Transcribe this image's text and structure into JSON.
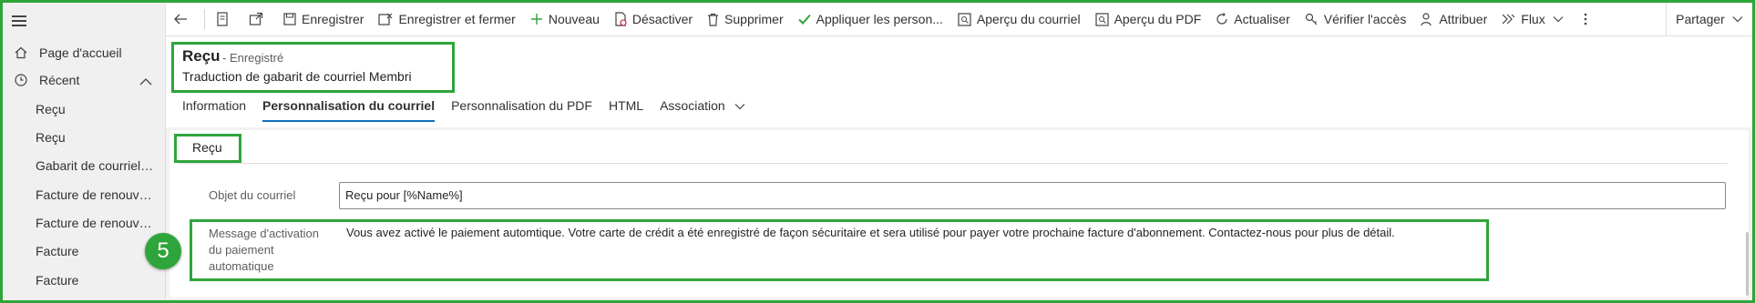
{
  "sidebar": {
    "items": [
      {
        "label": "Page d'accueil",
        "icon": "home-icon"
      },
      {
        "label": "Récent",
        "icon": "clock-icon"
      }
    ],
    "recent": [
      "Reçu",
      "Reçu",
      "Gabarit de courriels ...",
      "Facture de renouvell...",
      "Facture de renouvell...",
      "Facture",
      "Facture"
    ]
  },
  "toolbar": {
    "save": "Enregistrer",
    "save_close": "Enregistrer et fermer",
    "new": "Nouveau",
    "deactivate": "Désactiver",
    "delete": "Supprimer",
    "apply": "Appliquer les person...",
    "preview_email": "Aperçu du courriel",
    "preview_pdf": "Aperçu du PDF",
    "refresh": "Actualiser",
    "check_access": "Vérifier l'accès",
    "assign": "Attribuer",
    "flow": "Flux",
    "share": "Partager"
  },
  "header": {
    "title": "Reçu",
    "status": "- Enregistré",
    "subtitle": "Traduction de gabarit de courriel Membri"
  },
  "tabs": [
    "Information",
    "Personnalisation du courriel",
    "Personnalisation du PDF",
    "HTML",
    "Association"
  ],
  "section": {
    "label": "Reçu"
  },
  "fields": {
    "subject_label": "Objet du courriel",
    "subject_value": "Reçu pour [%Name%]",
    "message_label_1": "Message d'activation",
    "message_label_2": "du paiement",
    "message_label_3": "automatique",
    "message_value": "Vous avez activé le paiement automtique. Votre carte de crédit a été enregistré de façon sécuritaire et sera utilisé pour payer votre prochaine facture d'abonnement. Contactez-nous pour plus de détail."
  },
  "annotation": {
    "step": "5"
  },
  "colors": {
    "highlight": "#2ea53a",
    "accent": "#0f6cbd"
  }
}
